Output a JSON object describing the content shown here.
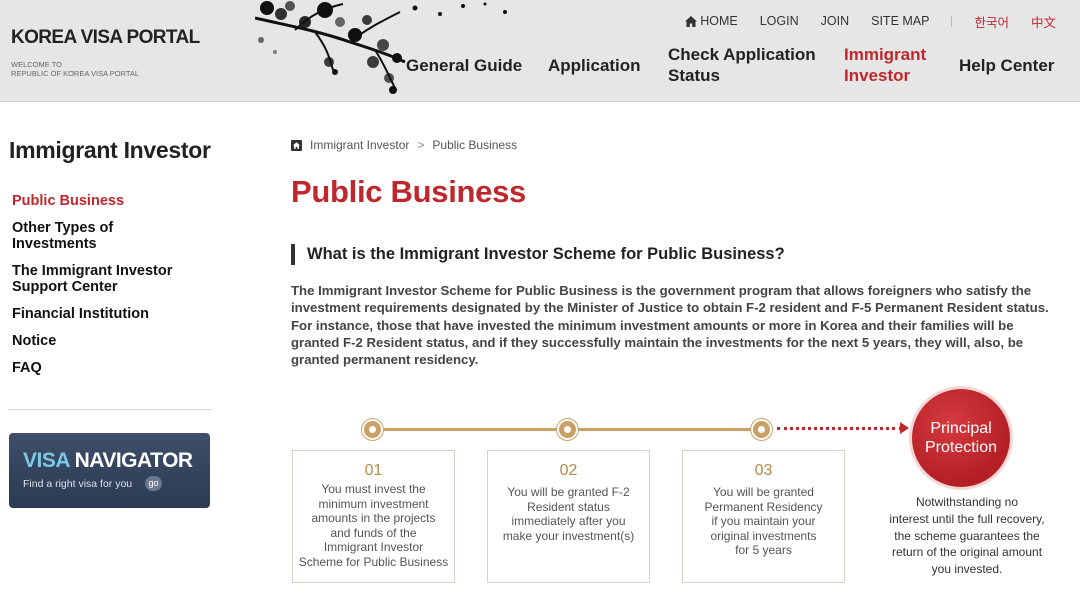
{
  "header": {
    "logo_title": "KOREA VISA PORTAL",
    "logo_sub_line1": "WELCOME TO",
    "logo_sub_line2": "REPUBLIC OF KOREA VISA PORTAL",
    "util": {
      "home": "HOME",
      "login": "LOGIN",
      "join": "JOIN",
      "sitemap": "SITE MAP",
      "lang_ko": "한국어",
      "lang_zh": "中文"
    },
    "nav": [
      {
        "line1": "General Guide",
        "line2": ""
      },
      {
        "line1": "Application",
        "line2": ""
      },
      {
        "line1": "Check Application",
        "line2": "Status"
      },
      {
        "line1": "Immigrant",
        "line2": "Investor"
      },
      {
        "line1": "Help Center",
        "line2": ""
      }
    ],
    "active_nav_color": "#c0272d"
  },
  "sidebar": {
    "title": "Immigrant Investor",
    "items": [
      {
        "line1": "Public Business",
        "line2": ""
      },
      {
        "line1": "Other Types of",
        "line2": "Investments"
      },
      {
        "line1": "The Immigrant Investor",
        "line2": "Support Center"
      },
      {
        "line1": "Financial Institution",
        "line2": ""
      },
      {
        "line1": "Notice",
        "line2": ""
      },
      {
        "line1": "FAQ",
        "line2": ""
      }
    ],
    "banner": {
      "title_accent": "VISA",
      "title_rest": " NAVIGATOR",
      "sub": "Find a right visa for you",
      "go": "go"
    }
  },
  "main": {
    "breadcrumb": [
      "Immigrant Investor",
      ">",
      "Public Business"
    ],
    "title": "Public Business",
    "section_heading": "What is the Immigrant Investor Scheme for Public Business?",
    "intro": "The Immigrant Investor Scheme for Public Business is the government program that allows foreigners who satisfy the investment requirements designated by the Minister of Justice to obtain F-2 resident and F-5 Permanent Resident status. For instance, those that have invested the minimum investment amounts or more in Korea and their families will be granted F-2 Resident status, and if they successfully maintain the investments for the next 5 years, they will, also, be granted permanent residency.",
    "steps": [
      {
        "num": "01",
        "lines": [
          "You must invest the",
          "minimum investment",
          "amounts in the projects",
          "and funds of the",
          "Immigrant Investor",
          "Scheme for Public Business"
        ]
      },
      {
        "num": "02",
        "lines": [
          "You will be granted F-2",
          "Resident status",
          "immediately after you",
          "make your investment(s)"
        ]
      },
      {
        "num": "03",
        "lines": [
          "You will be granted",
          "Permanent Residency",
          "if you maintain your",
          "original investments",
          "for 5 years"
        ]
      }
    ],
    "principal": {
      "line1": "Principal",
      "line2": "Protection",
      "desc_lines": [
        "Notwithstanding no",
        "interest until the full recovery,",
        "the scheme  guarantees the",
        "return of the original amount",
        "you invested."
      ]
    },
    "colors": {
      "accent": "#c0272d",
      "gold": "#c9a066"
    }
  }
}
